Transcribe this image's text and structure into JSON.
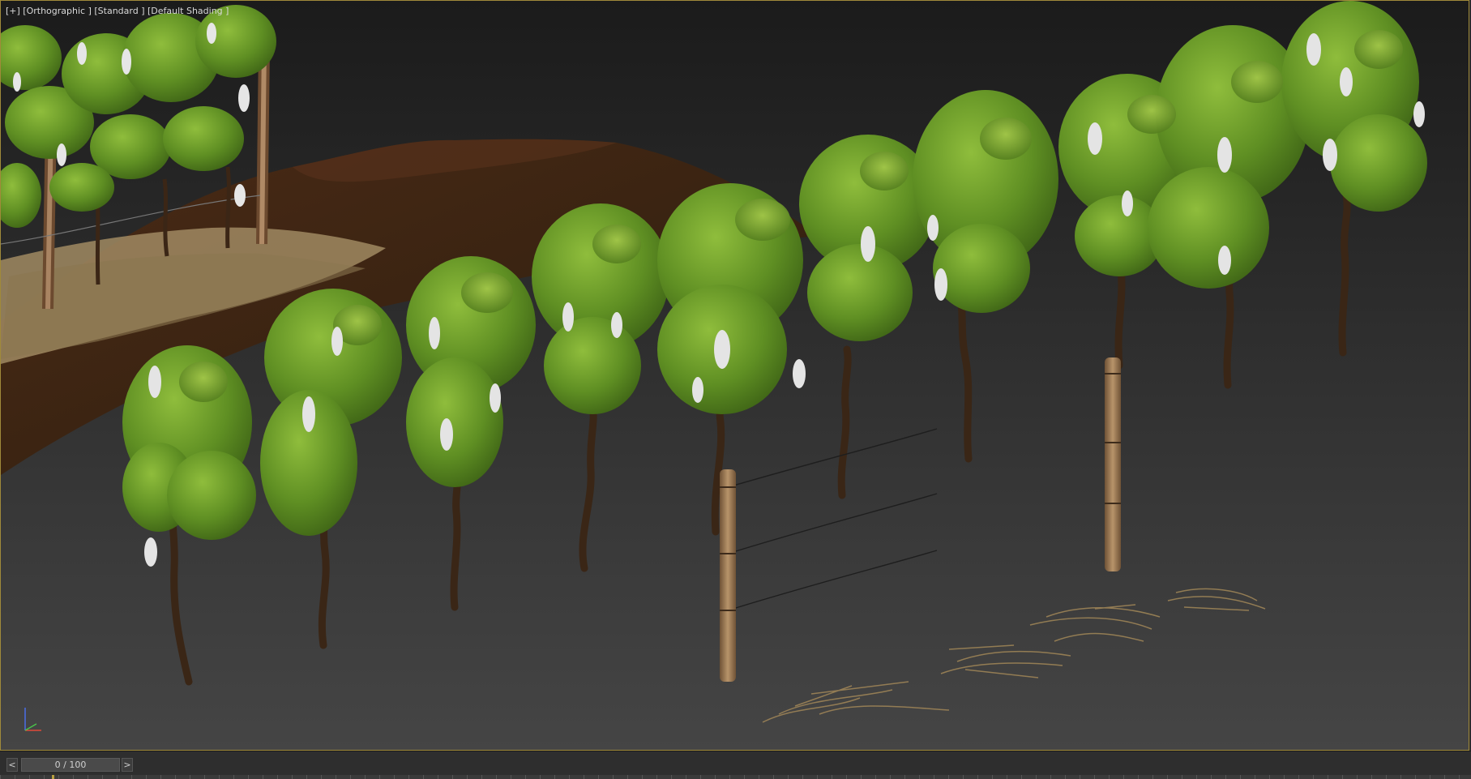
{
  "viewport": {
    "label": "[+] [Orthographic ] [Standard ] [Default Shading ]",
    "objects": [
      "grapevine",
      "wooden-post",
      "trellis-wire",
      "straw-clump",
      "terrain"
    ]
  },
  "gizmo": {
    "icon": "axis-tripod-icon"
  },
  "timeline": {
    "prev_label": "<",
    "next_label": ">",
    "frame_display": "0 / 100",
    "current_frame": 0,
    "total_frames": 100
  },
  "colors": {
    "viewport_border": "#a08a3a",
    "leaf_green": "#6c9d2a",
    "blossom": "#e6e6e6",
    "post_wood": "#a47e55",
    "soil": "#3f2213",
    "straw": "#9c8356"
  }
}
